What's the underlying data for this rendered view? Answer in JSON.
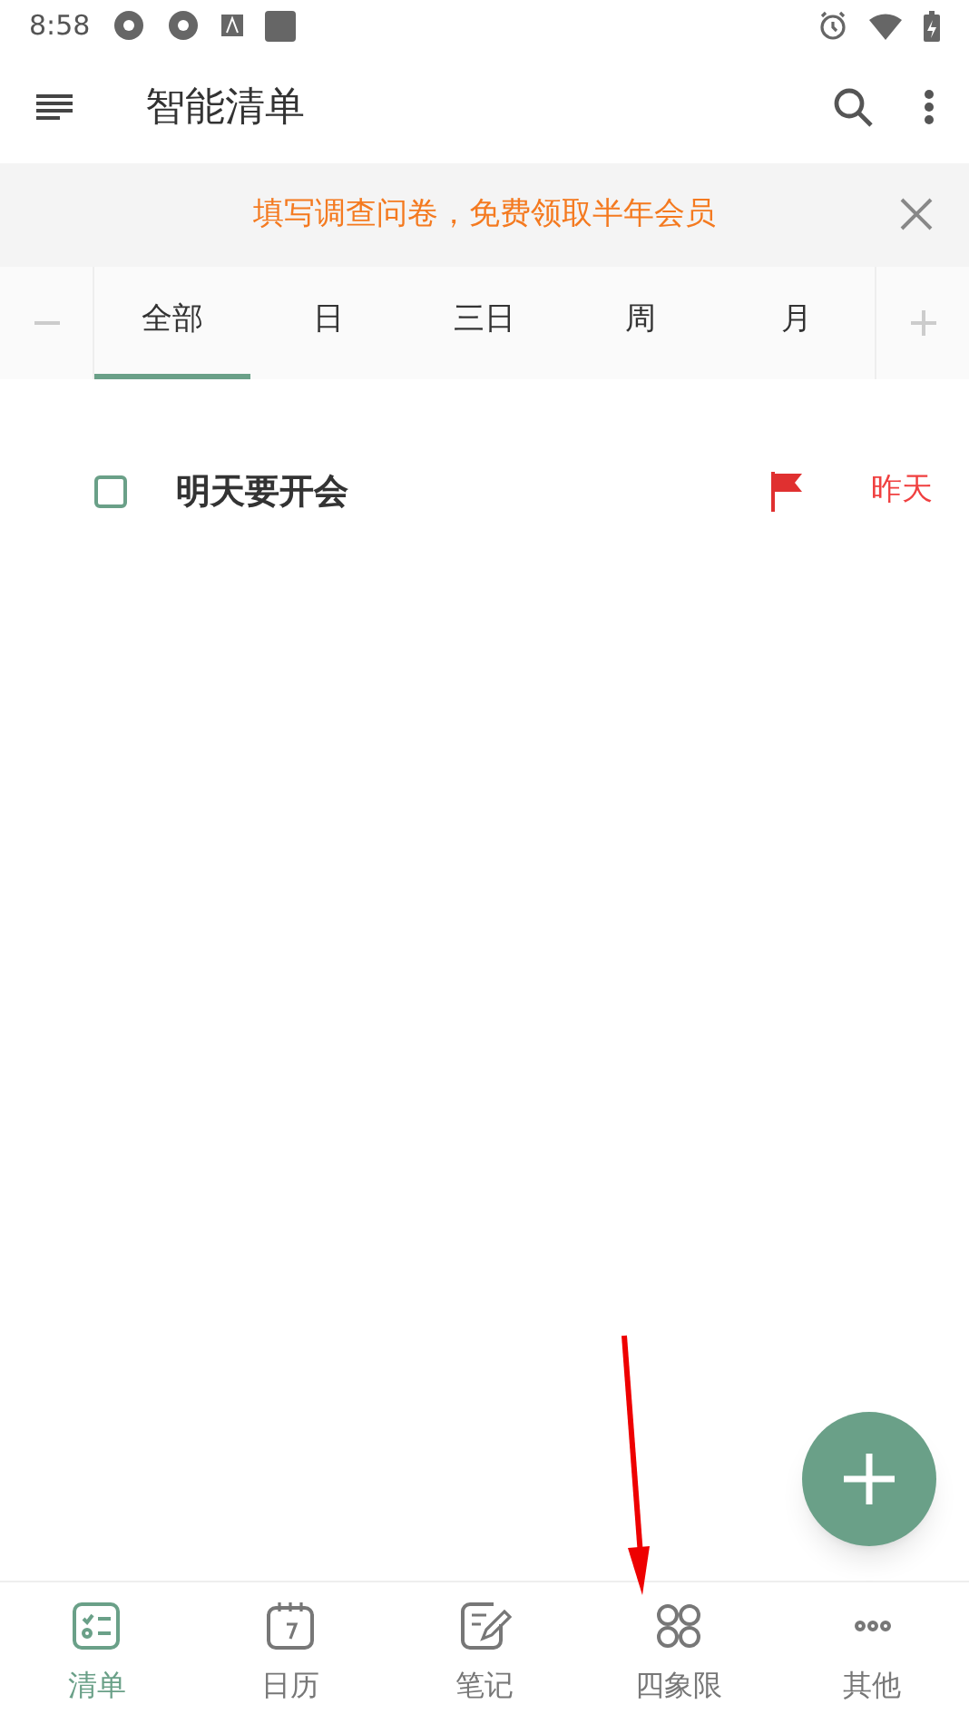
{
  "status_bar": {
    "time": "8:58"
  },
  "app_bar": {
    "title": "智能清单"
  },
  "banner": {
    "text": "填写调查问卷，免费领取半年会员"
  },
  "tabs": [
    {
      "label": "全部",
      "selected": true
    },
    {
      "label": "日",
      "selected": false
    },
    {
      "label": "三日",
      "selected": false
    },
    {
      "label": "周",
      "selected": false
    },
    {
      "label": "月",
      "selected": false
    }
  ],
  "tasks": [
    {
      "title": "明天要开会",
      "checked": false,
      "flagged": true,
      "due": "昨天"
    }
  ],
  "bottom_nav": [
    {
      "label": "清单",
      "kind": "list",
      "selected": true
    },
    {
      "label": "日历",
      "kind": "calendar",
      "selected": false
    },
    {
      "label": "笔记",
      "kind": "note",
      "selected": false
    },
    {
      "label": "四象限",
      "kind": "quadrant",
      "selected": false
    },
    {
      "label": "其他",
      "kind": "more",
      "selected": false
    }
  ]
}
